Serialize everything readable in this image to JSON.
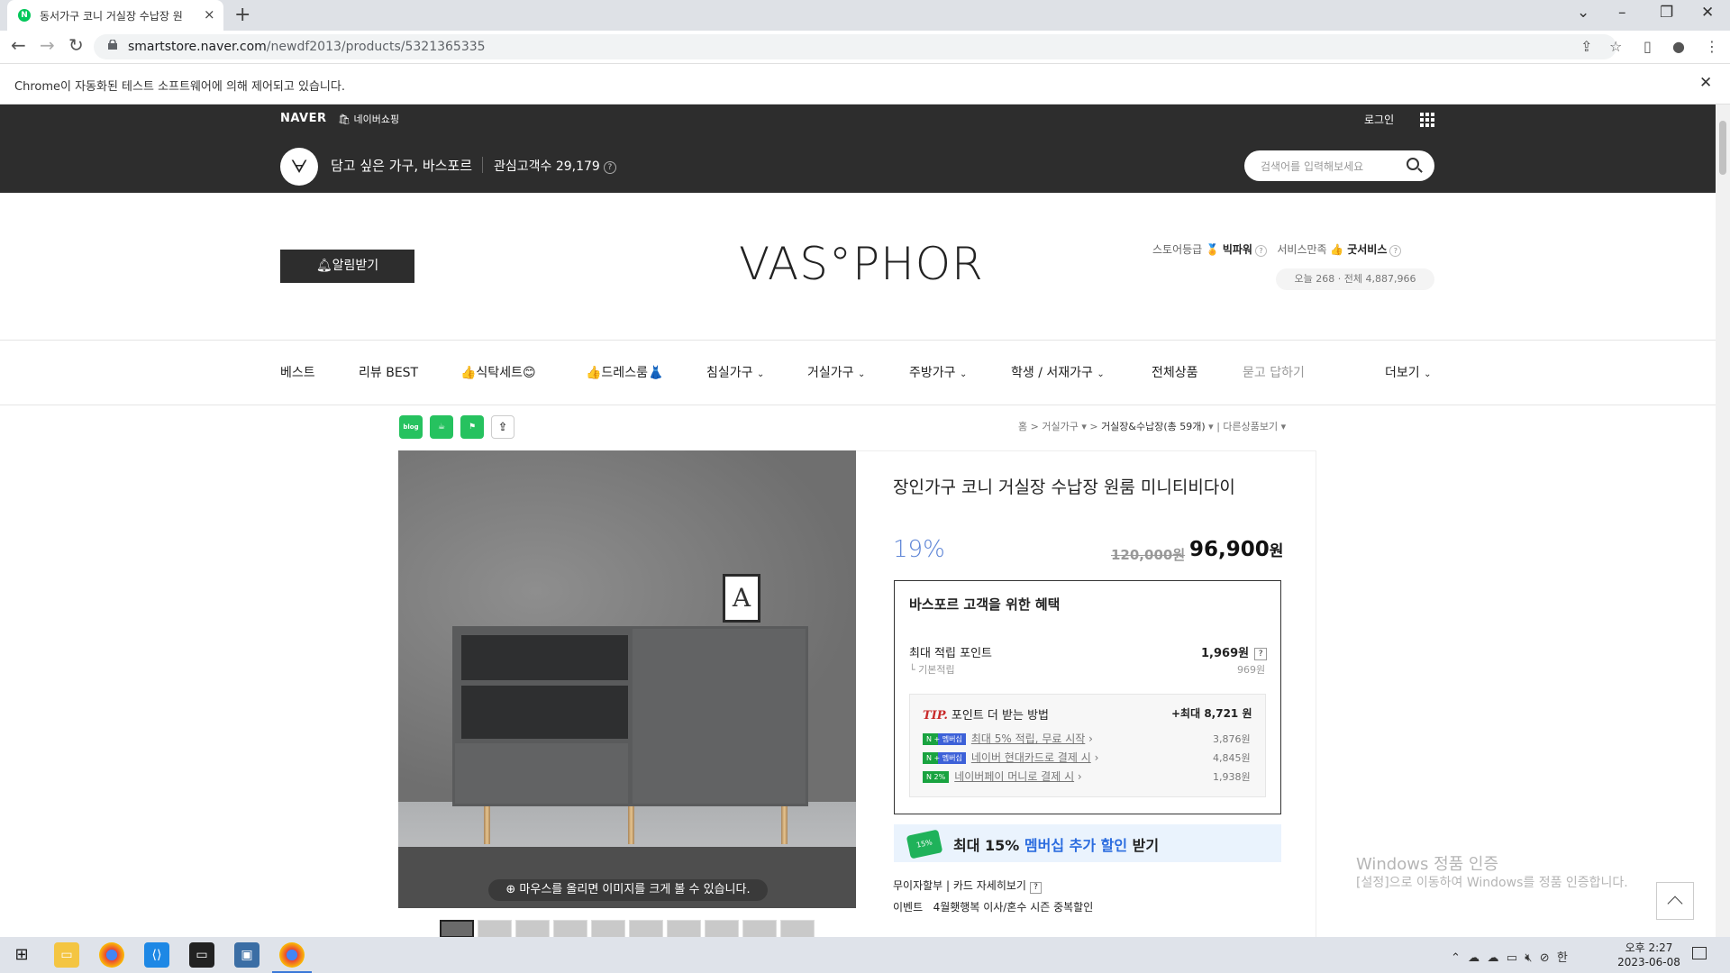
{
  "browser": {
    "tab_title": "동서가구 코니 거실장 수납장 원",
    "url_host": "smartstore.naver.com",
    "url_path": "/newdf2013/products/5321365335",
    "infobar_message": "Chrome이 자동화된 테스트 소프트웨어에 의해 제어되고 있습니다."
  },
  "naver_header": {
    "logo": "NAVER",
    "shopping": "네이버쇼핑",
    "login": "로그인",
    "store_name": "담고 싶은 가구, 바스포르",
    "followers": "관심고객수 29,179",
    "search_placeholder": "검색어를 입력해보세요"
  },
  "brand": {
    "alert_button": "알림받기",
    "logo_text": "VAS°PHOR",
    "store_grade_label": "스토어등급",
    "store_grade": "빅파워",
    "service_label": "서비스만족",
    "service_grade": "굿서비스",
    "visits": "오늘 268 · 전체 4,887,966"
  },
  "nav": {
    "items": [
      "베스트",
      "리뷰 BEST",
      "👍식탁세트😊",
      "👍드레스룸👗",
      "침실가구",
      "거실가구",
      "주방가구",
      "학생 / 서재가구",
      "전체상품",
      "묻고 답하기",
      "더보기"
    ]
  },
  "share": {
    "blog": "blog"
  },
  "breadcrumb": {
    "home": "홈",
    "level1": "거실가구",
    "level2": "거실장&수납장(총 59개)",
    "other": "다른상품보기"
  },
  "product": {
    "image_hint": "마우스를 올리면 이미지를 크게 볼 수 있습니다.",
    "frame_letter": "A",
    "title": "장인가구 코니 거실장 수납장 원룸 미니티비다이",
    "discount": "19%",
    "original_price": "120,000원",
    "price": "96,900",
    "price_unit": "원"
  },
  "benefit": {
    "heading": "바스포르 고객을 위한 혜택",
    "max_points_label": "최대 적립 포인트",
    "max_points_value": "1,969원",
    "basic_label": "└ 기본적립",
    "basic_value": "969원",
    "tip_label": "TIP.",
    "tip_text": "포인트 더 받는 방법",
    "tip_max": "+최대 8,721 원",
    "tip_rows": [
      {
        "badge": "N + 멤버십",
        "text": "최대 5% 적립, 무료 시작",
        "value": "3,876원"
      },
      {
        "badge": "N + 멤버십",
        "text": "네이버 현대카드로 결제 시",
        "value": "4,845원"
      },
      {
        "badge": "N 2%",
        "text": "네이버페이 머니로 결제 시",
        "value": "1,938원"
      }
    ]
  },
  "membership_banner": {
    "pre": "최대 15% ",
    "highlight": "멤버십 추가 할인",
    "post": " 받기"
  },
  "payment": {
    "installment": "무이자할부",
    "card_detail": "카드 자세히보기"
  },
  "event": {
    "label": "이벤트",
    "text": "4월횃행복 이사/혼수 시즌 중복할인"
  },
  "watermark": {
    "line1": "Windows 정품 인증",
    "line2": "[설정]으로 이동하여 Windows를 정품 인증합니다."
  },
  "taskbar": {
    "time": "오후 2:27",
    "date": "2023-06-08",
    "ime": "한"
  }
}
